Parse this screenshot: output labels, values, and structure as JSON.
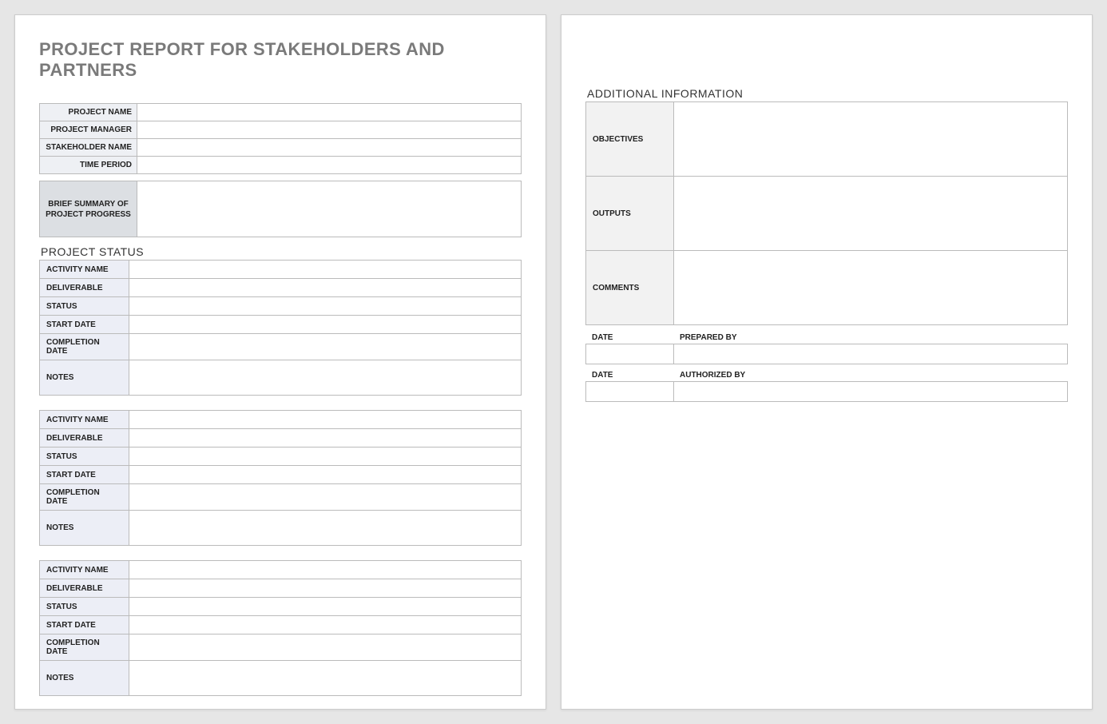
{
  "title": "PROJECT REPORT FOR STAKEHOLDERS AND PARTNERS",
  "header_fields": {
    "project_name_label": "PROJECT NAME",
    "project_name_value": "",
    "project_manager_label": "PROJECT MANAGER",
    "project_manager_value": "",
    "stakeholder_name_label": "STAKEHOLDER NAME",
    "stakeholder_name_value": "",
    "time_period_label": "TIME PERIOD",
    "time_period_value": ""
  },
  "summary": {
    "label": "BRIEF SUMMARY OF PROJECT PROGRESS",
    "value": ""
  },
  "project_status_heading": "PROJECT STATUS",
  "activity_labels": {
    "activity_name": "ACTIVITY NAME",
    "deliverable": "DELIVERABLE",
    "status": "STATUS",
    "start_date": "START DATE",
    "completion_date": "COMPLETION DATE",
    "notes": "NOTES"
  },
  "activities": [
    {
      "activity_name": "",
      "deliverable": "",
      "status": "",
      "start_date": "",
      "completion_date": "",
      "notes": ""
    },
    {
      "activity_name": "",
      "deliverable": "",
      "status": "",
      "start_date": "",
      "completion_date": "",
      "notes": ""
    },
    {
      "activity_name": "",
      "deliverable": "",
      "status": "",
      "start_date": "",
      "completion_date": "",
      "notes": ""
    }
  ],
  "additional_heading": "ADDITIONAL INFORMATION",
  "additional": {
    "objectives_label": "OBJECTIVES",
    "objectives_value": "",
    "outputs_label": "OUTPUTS",
    "outputs_value": "",
    "comments_label": "COMMENTS",
    "comments_value": ""
  },
  "signoff": {
    "date_label": "DATE",
    "prepared_by_label": "PREPARED BY",
    "authorized_by_label": "AUTHORIZED BY",
    "prepared_date": "",
    "prepared_by": "",
    "authorized_date": "",
    "authorized_by": ""
  }
}
